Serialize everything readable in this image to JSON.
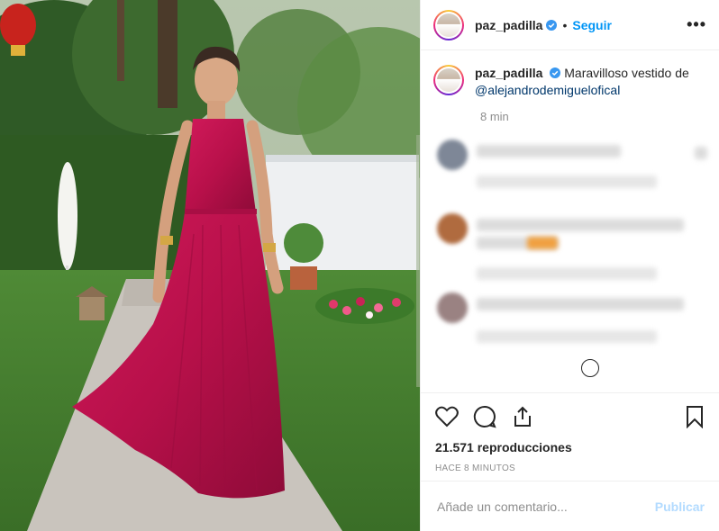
{
  "post": {
    "username": "paz_padilla",
    "follow_label": "Seguir",
    "separator": "•",
    "more_label": "•••"
  },
  "caption": {
    "username": "paz_padilla",
    "text": "Maravilloso vestido de",
    "mention": "@alejandrodemiguelofical",
    "time": "8 min"
  },
  "stats": {
    "views": "21.571 reproducciones",
    "ago": "HACE 8 MINUTOS"
  },
  "comment_box": {
    "placeholder": "Añade un comentario...",
    "publish_label": "Publicar"
  },
  "colors": {
    "accent": "#0095f6",
    "dress": "#c2134f"
  },
  "icons": [
    "heart-icon",
    "comment-icon",
    "share-icon",
    "bookmark-icon",
    "verified-icon",
    "load-more-icon"
  ]
}
